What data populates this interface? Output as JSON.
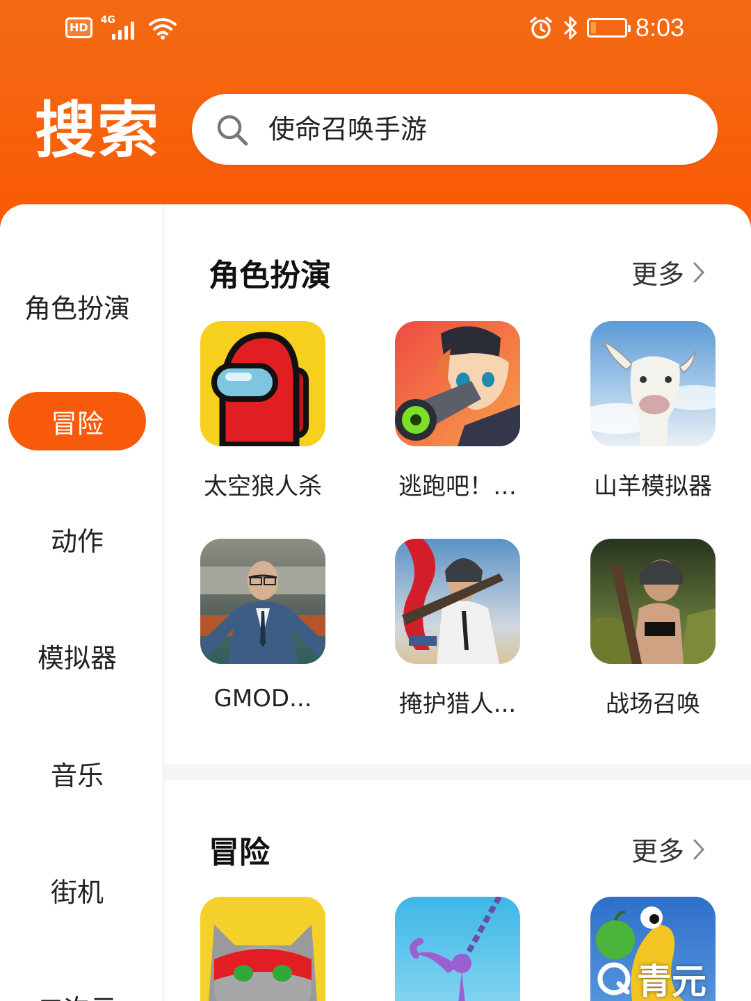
{
  "status_bar": {
    "hd_label": "HD",
    "network_label": "4G",
    "time": "8:03",
    "icons": [
      "signal-icon",
      "wifi-icon",
      "alarm-icon",
      "bluetooth-icon",
      "battery-icon"
    ],
    "battery_level": 0.15
  },
  "header": {
    "title": "搜索",
    "search_value": "使命召唤手游",
    "accent_color": "#f65a0a"
  },
  "sidebar": {
    "items": [
      {
        "label": "角色扮演",
        "active": false
      },
      {
        "label": "冒险",
        "active": true
      },
      {
        "label": "动作",
        "active": false
      },
      {
        "label": "模拟器",
        "active": false
      },
      {
        "label": "音乐",
        "active": false
      },
      {
        "label": "街机",
        "active": false
      },
      {
        "label": "二次元",
        "active": false
      }
    ]
  },
  "sections": [
    {
      "title": "角色扮演",
      "more_label": "更多",
      "apps": [
        {
          "name": "太空狼人杀"
        },
        {
          "name": "逃跑吧！…"
        },
        {
          "name": "山羊模拟器"
        },
        {
          "name": "GMOD..."
        },
        {
          "name": "掩护猎人..."
        },
        {
          "name": "战场召唤"
        }
      ]
    },
    {
      "title": "冒险",
      "more_label": "更多",
      "apps": [
        {
          "name": ""
        },
        {
          "name": ""
        },
        {
          "name": ""
        }
      ]
    }
  ],
  "watermark": {
    "text": "青元"
  }
}
